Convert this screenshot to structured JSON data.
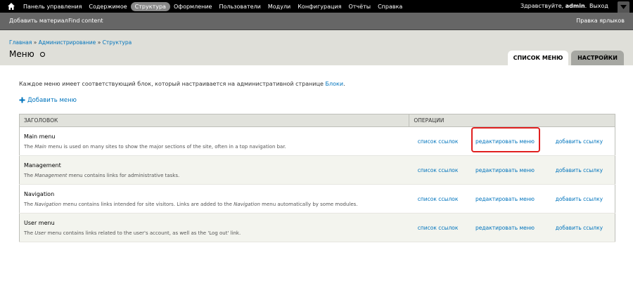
{
  "toolbar": {
    "home_icon": "home-icon",
    "items": [
      {
        "label": "Панель управления"
      },
      {
        "label": "Содержимое"
      },
      {
        "label": "Структура",
        "active": true
      },
      {
        "label": "Оформление"
      },
      {
        "label": "Пользователи"
      },
      {
        "label": "Модули"
      },
      {
        "label": "Конфигурация"
      },
      {
        "label": "Отчёты"
      },
      {
        "label": "Справка"
      }
    ],
    "greeting_prefix": "Здравствуйте,",
    "username": "admin",
    "greeting_suffix": ".",
    "logout": "Выход"
  },
  "shortcuts": {
    "items": [
      "Добавить материал",
      "Find content"
    ],
    "edit": "Правка ярлыков"
  },
  "header": {
    "breadcrumb": [
      "Главная",
      "Администрирование",
      "Структура"
    ],
    "breadcrumb_sep": "»",
    "title": "Меню",
    "tabs": [
      {
        "label": "СПИСОК МЕНЮ",
        "active": true
      },
      {
        "label": "НАСТРОЙКИ",
        "active": false
      }
    ]
  },
  "content": {
    "help_text": "Каждое меню имеет соответствующий блок, который настраивается на административной странице",
    "help_link": "Блоки",
    "help_end": ".",
    "add_menu": "Добавить меню",
    "table": {
      "headers": [
        "ЗАГОЛОВОК",
        "ОПЕРАЦИИ"
      ],
      "rows": [
        {
          "name": "Main menu",
          "desc_before": "The",
          "desc_em": "Main",
          "desc_after": "menu is used on many sites to show the major sections of the site, often in a top navigation bar.",
          "ops": [
            "список ссылок",
            "редактировать меню",
            "добавить ссылку"
          ]
        },
        {
          "name": "Management",
          "desc_before": "The",
          "desc_em": "Management",
          "desc_after": "menu contains links for administrative tasks.",
          "ops": [
            "список ссылок",
            "редактировать меню",
            "добавить ссылку"
          ]
        },
        {
          "name": "Navigation",
          "desc_before": "The",
          "desc_em": "Navigation",
          "desc_after": "menu contains links intended for site visitors. Links are added to the",
          "desc_em2": "Navigation",
          "desc_after2": "menu automatically by some modules.",
          "ops": [
            "список ссылок",
            "редактировать меню",
            "добавить ссылку"
          ]
        },
        {
          "name": "User menu",
          "desc_before": "The",
          "desc_em": "User",
          "desc_after": "menu contains links related to the user's account, as well as the 'Log out' link.",
          "ops": [
            "список ссылок",
            "редактировать меню",
            "добавить ссылку"
          ]
        }
      ]
    }
  },
  "colors": {
    "link": "#0074bd",
    "highlight": "#e02020"
  }
}
